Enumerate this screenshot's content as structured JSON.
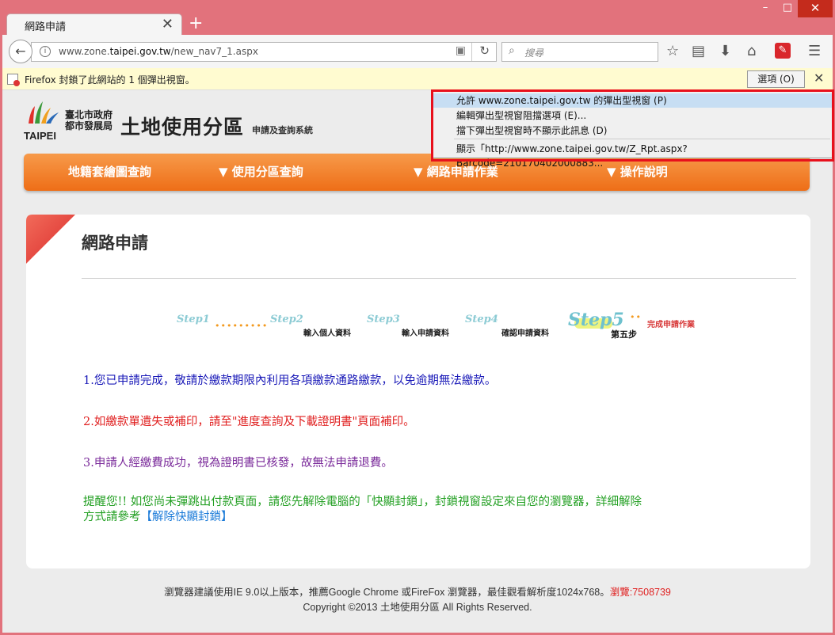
{
  "browser": {
    "tab_title": "網路申請",
    "tab_close": "✕",
    "new_tab": "+",
    "window_controls": {
      "minimize": "–",
      "maximize": "□",
      "close": "✕"
    },
    "url_prefix": "www.zone.",
    "url_domain": "taipei.gov.tw",
    "url_path": "/new_nav7_1.aspx",
    "search_placeholder": "搜尋",
    "icons": [
      "back-icon",
      "info-icon",
      "reader-icon",
      "reload-icon",
      "search-icon",
      "bookmark-star-icon",
      "library-icon",
      "download-icon",
      "home-icon",
      "pdf-icon",
      "menu-icon"
    ]
  },
  "notification": {
    "text": "Firefox 封鎖了此網站的 1 個彈出視窗。",
    "options_button": "選項 (O)",
    "close": "✕"
  },
  "popup_menu": {
    "items": [
      "允許 www.zone.taipei.gov.tw 的彈出型視窗 (P)",
      "編輯彈出型視窗阻擋選項 (E)...",
      "擋下彈出型視窗時不顯示此訊息 (D)",
      "顯示「http://www.zone.taipei.gov.tw/Z_Rpt.aspx?Barcode=210170402000883..."
    ]
  },
  "header": {
    "logo_taipei": "TAIPEI",
    "city_line1": "臺北市政府",
    "city_line2": "都市發展局",
    "site_title": "土地使用分區",
    "site_subtitle": "申請及查詢系統"
  },
  "nav": {
    "items": [
      "地籍套繪圖查詢",
      "▼ 使用分區查詢",
      "▼ 網路申請作業",
      "▼ 操作說明"
    ]
  },
  "main": {
    "title": "網路申請",
    "steps": {
      "step_words": [
        "Step1",
        "Step2",
        "Step3",
        "Step4"
      ],
      "labels": [
        "輸入個人資料",
        "輸入申請資料",
        "確認申請資料"
      ],
      "step5": "Step5",
      "step5_sub": "第五步",
      "step5_label": "完成申請作業"
    },
    "messages": {
      "m1": "1.您已申請完成，敬請於繳款期限內利用各項繳款通路繳款，以免逾期無法繳款。",
      "m2": "2.如繳款單遺失或補印，請至\"進度查詢及下載證明書\"頁面補印。",
      "m3": "3.申請人經繳費成功，視為證明書已核發，故無法申請退費。",
      "m4_line1": "提醒您!! 如您尚未彈跳出付款頁面，請您先解除電腦的「快顯封鎖」，封鎖視窗設定來自您的瀏覽器，詳細解除",
      "m4_line2": "方式請參考",
      "m4_link": "【解除快顯封鎖】"
    }
  },
  "footer": {
    "line1": "瀏覽器建議使用IE 9.0以上版本，推薦Google Chrome 或FireFox 瀏覽器，最佳觀看解析度1024x768。",
    "views_label": "瀏覽:7508739",
    "line2": "Copyright ©2013 土地使用分區 All Rights Reserved."
  },
  "colors": {
    "window_frame": "#e2727c",
    "menu_orange": "#ee6e17",
    "highlight_box": "#e8101c",
    "step_blue": "#8ccbd4"
  }
}
